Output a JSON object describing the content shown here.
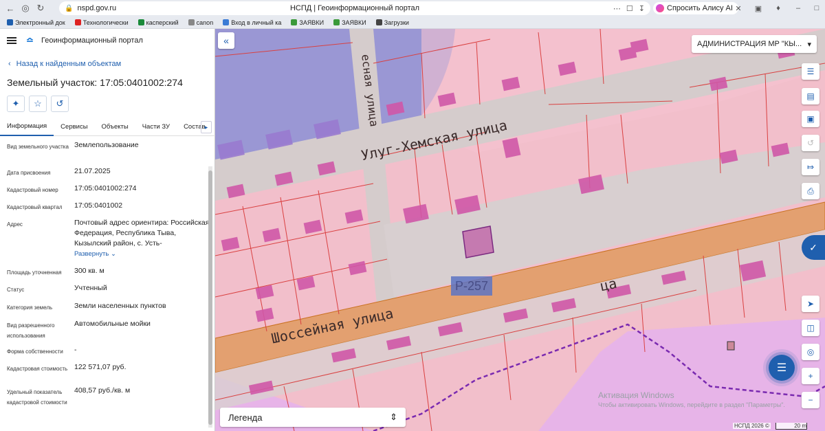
{
  "browser": {
    "url": "nspd.gov.ru",
    "tab_title": "НСПД | Геоинформационный портал",
    "alice_label": "Спросить Алису AI"
  },
  "bookmarks": [
    {
      "label": "Электронный док",
      "color": "#1f5fae"
    },
    {
      "label": "Технологически",
      "color": "#d22"
    },
    {
      "label": "касперский",
      "color": "#1a8a3a"
    },
    {
      "label": "canon",
      "color": "#888"
    },
    {
      "label": "Вход в личный ка",
      "color": "#3a7bd5"
    },
    {
      "label": "ЗАЯВКИ",
      "color": "#3a9a3a"
    },
    {
      "label": "ЗАЯВКИ",
      "color": "#3a9a3a"
    },
    {
      "label": "Загрузки",
      "color": "#444"
    }
  ],
  "panel": {
    "app_title": "Геоинформационный портал",
    "back_label": "Назад к найденным объектам",
    "title": "Земельный участок: 17:05:0401002:274",
    "tabs": [
      "Информация",
      "Сервисы",
      "Объекты",
      "Части ЗУ",
      "Состав"
    ],
    "expand_label": "Развернуть",
    "fields": [
      {
        "label": "Вид земельного участка",
        "value": "Землепользование"
      },
      {
        "label": "Дата присвоения",
        "value": "21.07.2025"
      },
      {
        "label": "Кадастровый номер",
        "value": "17:05:0401002:274"
      },
      {
        "label": "Кадастровый квартал",
        "value": "17:05:0401002"
      },
      {
        "label": "Адрес",
        "value": "Почтовый адрес ориентира: Российская Федерация, Республика Тыва, Кызылский район, с. Усть-"
      },
      {
        "label": "Площадь уточненная",
        "value": "300 кв. м"
      },
      {
        "label": "Статус",
        "value": "Учтенный"
      },
      {
        "label": "Категория земель",
        "value": "Земли населенных пунктов"
      },
      {
        "label": "Вид разрешенного использования",
        "value": "Автомобильные мойки"
      },
      {
        "label": "Форма собственности",
        "value": "-"
      },
      {
        "label": "Кадастровая стоимость",
        "value": "122 571,07 руб."
      },
      {
        "label": "Удельный показатель кадастровой стоимости",
        "value": "408,57 руб./кв. м"
      }
    ]
  },
  "map": {
    "region_select": "АДМИНИСТРАЦИЯ МР \"КЫ...",
    "legend_label": "Легенда",
    "road_labels": [
      "Улуг-Хемская улица",
      "Шоссейная улица",
      "есная улица",
      "ца"
    ],
    "road_badge": "Р-257",
    "watermark_title": "Активация Windows",
    "watermark_sub": "Чтобы активировать Windows, перейдите в раздел \"Параметры\".",
    "copyright": "НСПД 2026 ©",
    "scale": "20 m"
  }
}
